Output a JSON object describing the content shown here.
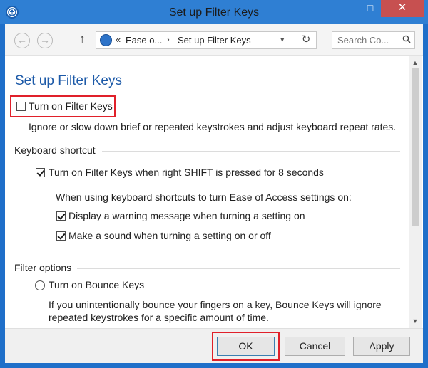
{
  "window": {
    "title": "Set up Filter Keys",
    "minimize": "—",
    "maximize": "□",
    "close": "✕"
  },
  "address_bar": {
    "chevron": "«",
    "crumb1": "Ease o...",
    "separator": "›",
    "crumb2": "Set up Filter Keys",
    "dropdown": "▾",
    "refresh": "↻"
  },
  "search": {
    "placeholder": "Search Co...",
    "icon": "search-icon"
  },
  "page": {
    "title": "Set up Filter Keys",
    "filter_keys_toggle": {
      "label": "Turn on Filter Keys",
      "checked": false
    },
    "filter_keys_desc": "Ignore or slow down brief or repeated keystrokes and adjust keyboard repeat rates.",
    "keyboard_shortcut": {
      "heading": "Keyboard shortcut",
      "shortcut_toggle": {
        "label": "Turn on Filter Keys when right SHIFT is pressed for 8 seconds",
        "checked": true
      },
      "sub_heading": "When using keyboard shortcuts to turn Ease of Access settings on:",
      "warning_option": {
        "label": "Display a warning message when turning a setting on",
        "checked": true
      },
      "sound_option": {
        "label": "Make a sound when turning a setting on or off",
        "checked": true
      }
    },
    "filter_options": {
      "heading": "Filter options",
      "bounce_keys": {
        "label": "Turn on Bounce Keys",
        "selected": false
      },
      "bounce_desc_line1": "If you unintentionally bounce your fingers on a key, Bounce Keys will ignore",
      "bounce_desc_line2": "repeated keystrokes for a specific amount of time."
    }
  },
  "scrollbar": {
    "up": "▲",
    "down": "▼"
  },
  "buttons": {
    "ok": "OK",
    "cancel": "Cancel",
    "apply": "Apply"
  },
  "colors": {
    "title_bar": "#2f7fd3",
    "close_button": "#c75050",
    "page_title": "#1d5aa8",
    "highlight_box": "#e0202a"
  }
}
